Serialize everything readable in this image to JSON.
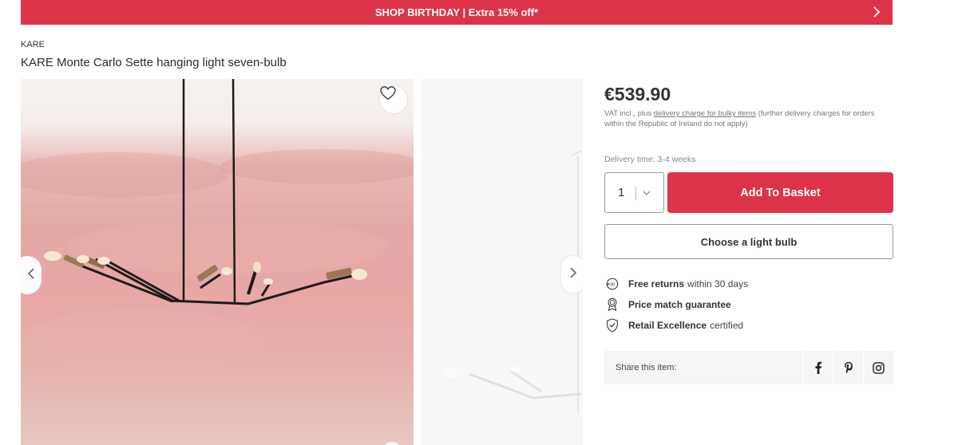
{
  "promo": {
    "text": "SHOP BIRTHDAY | Extra 15% off*"
  },
  "product": {
    "brand": "KARE",
    "title": "KARE Monte Carlo Sette hanging light seven-bulb",
    "price": "€539.90",
    "vat_prefix": "VAT incl., plus ",
    "vat_link": "delivery charge for bulky items",
    "vat_suffix": " (further delivery charges for orders within the Republic of Ireland do not apply)",
    "delivery_time": "Delivery time: 3-4 weeks",
    "quantity": "1"
  },
  "actions": {
    "add_to_basket": "Add To Basket",
    "choose_bulb": "Choose a light bulb"
  },
  "usps": [
    {
      "icon": "returns-30-icon",
      "bold": "Free returns",
      "text": "within 30 days"
    },
    {
      "icon": "award-ribbon-icon",
      "bold": "Price match guarantee",
      "text": ""
    },
    {
      "icon": "shield-check-icon",
      "bold": "Retail Excellence",
      "text": "certified"
    }
  ],
  "share": {
    "label": "Share this item:",
    "icons": [
      "facebook-icon",
      "pinterest-icon",
      "instagram-icon"
    ]
  },
  "colors": {
    "accent": "#dc3349",
    "wall_pink": "#e4a9a7"
  }
}
